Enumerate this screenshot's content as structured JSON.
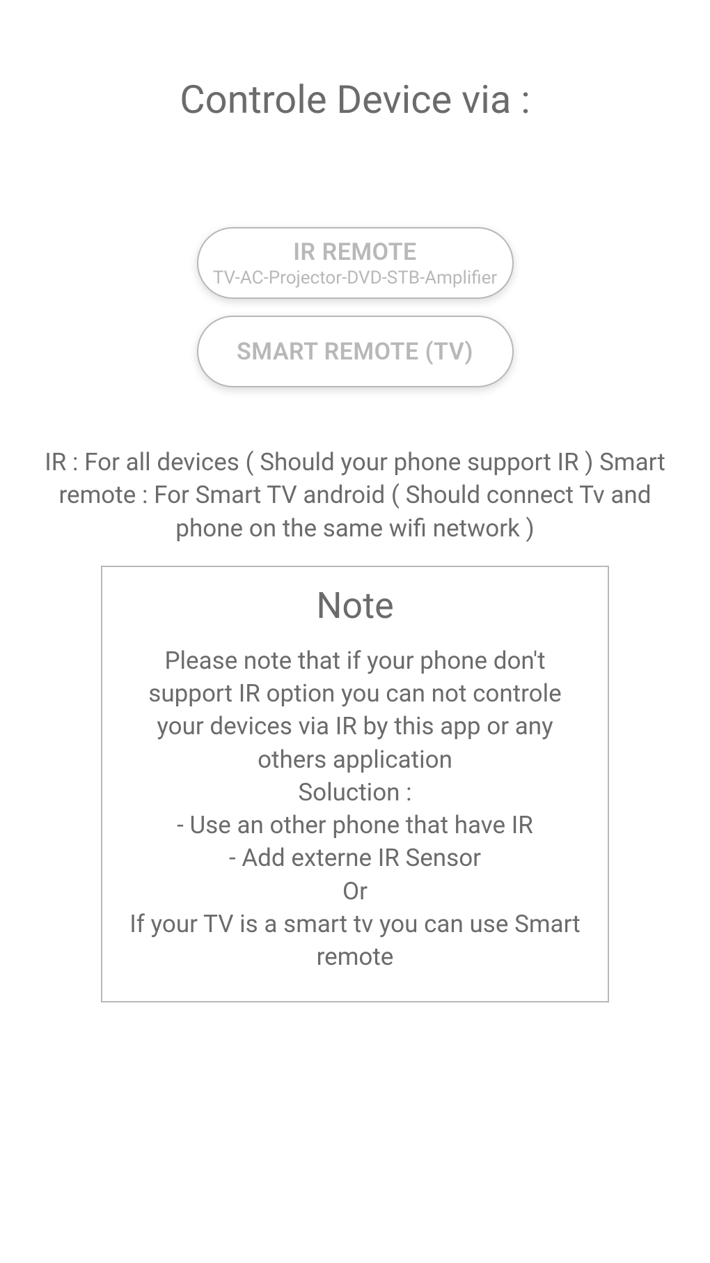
{
  "title": "Controle Device via :",
  "buttons": {
    "ir": {
      "label": "IR REMOTE",
      "subtitle": "TV-AC-Projector-DVD-STB-Amplifier"
    },
    "smart": {
      "label": "SMART REMOTE (TV)"
    }
  },
  "info": "IR : For all devices ( Should your phone support IR )\nSmart remote : For Smart TV android ( Should connect Tv and phone on the same wifi network )",
  "note": {
    "title": "Note",
    "body": "Please note that if your phone don't support IR option you can not controle your devices via IR by this app or any others application\nSoluction :\n- Use an other phone that have IR\n- Add externe IR Sensor\nOr\nIf your TV is a smart tv you can use Smart remote"
  }
}
